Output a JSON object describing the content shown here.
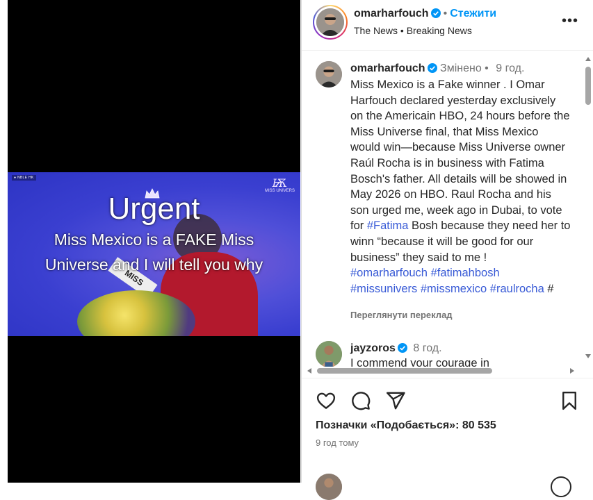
{
  "media": {
    "live_chip": "● NBLE HK",
    "logo_mark": "Ѭ",
    "logo_text": "MISS UNIVERS",
    "headline": "Urgent",
    "subline_1": "Miss Mexico is a FAKE Miss",
    "subline_2": "Universe and I will tell you why",
    "sash_text": "MISS"
  },
  "header": {
    "username": "omarharfouch",
    "separator": "•",
    "follow_label": "Стежити",
    "subtitle": "The News • Breaking News"
  },
  "caption": {
    "username": "omarharfouch",
    "edited": "Змінено",
    "separator": "•",
    "age": "9 год.",
    "text": "Miss Mexico is a Fake winner .  I Omar Harfouch declared yesterday exclusively on the Americain HBO, 24 hours before the Miss Universe final, that Miss Mexico would win—because Miss Universe owner Raúl Rocha is in business with Fatima Bosch's father. All details will be showed in May 2026 on HBO. Raul Rocha and his son urged me, week ago in Dubai, to vote for",
    "inline_tag": "#Fatima",
    "text_after": " Bosh because they need her to winn “because it will be good for our business” they said to me !",
    "hashtags_line1": "#omarharfouch #fatimahbosh",
    "hashtags_line2": "#missunivers #missmexico #raulrocha",
    "trailing": " #",
    "translate_label": "Переглянути переклад"
  },
  "comment": {
    "username": "jayzoros",
    "age": "8 год.",
    "text": "I commend your courage in"
  },
  "actions": {
    "likes_label": "Позначки «Подобається»: 80 535",
    "time_ago": "9 год тому"
  },
  "colors": {
    "link": "#0095f6",
    "hashtag": "#385ad6",
    "verified": "#0095f6",
    "muted": "#737373"
  }
}
